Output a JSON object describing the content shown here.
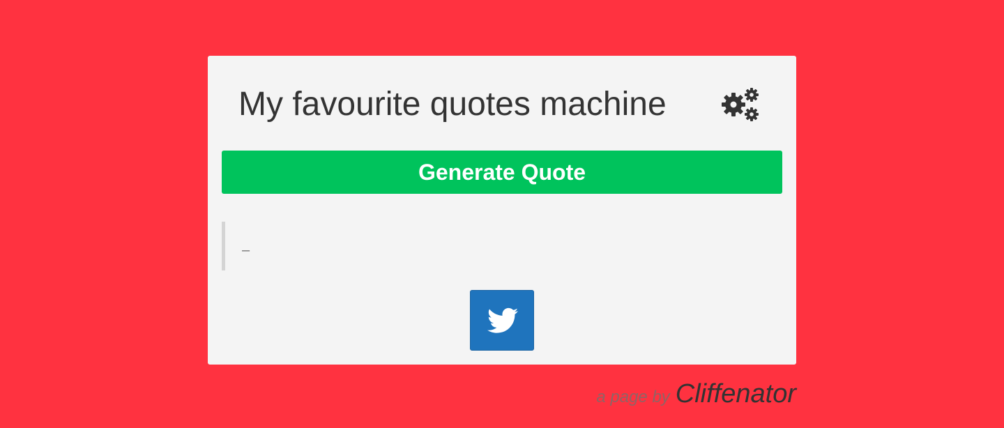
{
  "header": {
    "title": "My favourite quotes machine",
    "icon": "gears-icon"
  },
  "generate_button": {
    "label": "Generate Quote"
  },
  "quote": {
    "text": "",
    "author_prefix": "–",
    "author": ""
  },
  "tweet_button": {
    "icon": "twitter-icon"
  },
  "footer": {
    "prefix": "a page by",
    "author": "Cliffenator"
  },
  "colors": {
    "background": "#ff3240",
    "card": "#f4f4f4",
    "generate_button": "#00c35c",
    "tweet_button": "#1f74bd",
    "text": "#333333"
  }
}
